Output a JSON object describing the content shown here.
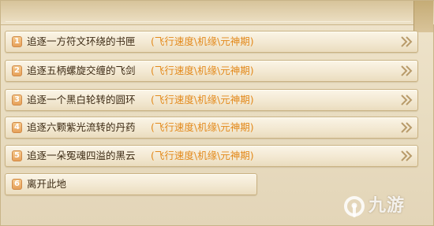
{
  "options": [
    {
      "number": "1",
      "text": "追逐一方符文环绕的书匣",
      "tag": "(飞行速度\\机缘\\元神期)"
    },
    {
      "number": "2",
      "text": "追逐五柄螺旋交缠的飞剑",
      "tag": "(飞行速度\\机缘\\元神期)"
    },
    {
      "number": "3",
      "text": "追逐一个黑白轮转的圆环",
      "tag": "(飞行速度\\机缘\\元神期)"
    },
    {
      "number": "4",
      "text": "追逐六颗紫光流转的丹药",
      "tag": "(飞行速度\\机缘\\元神期)"
    },
    {
      "number": "5",
      "text": "追逐一朵冤魂四溢的黑云",
      "tag": "(飞行速度\\机缘\\元神期)"
    },
    {
      "number": "6",
      "text": "离开此地"
    }
  ],
  "watermark": {
    "text": "九游"
  },
  "colors": {
    "panel": "#e9ddc2",
    "option_text": "#3d2b14",
    "tag_text": "#e38a1c",
    "badge": "#e6a05a",
    "border": "#c9b283"
  },
  "icons": {
    "option_arrow": "double-chevron-right-icon",
    "badge": "number-badge",
    "watermark_logo": "nine-game-logo-icon"
  }
}
